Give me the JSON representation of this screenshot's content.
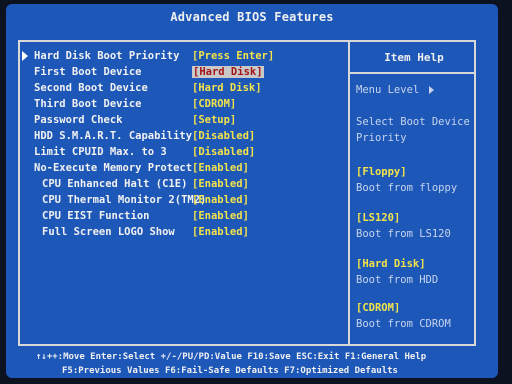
{
  "title": "Advanced BIOS Features",
  "items": [
    {
      "label": "Hard Disk Boot Priority",
      "value": "[Press Enter]"
    },
    {
      "label": "First Boot Device",
      "value": "[Hard Disk]"
    },
    {
      "label": "Second Boot Device",
      "value": "[Hard Disk]"
    },
    {
      "label": "Third Boot Device",
      "value": "[CDROM]"
    },
    {
      "label": "Password Check",
      "value": "[Setup]"
    },
    {
      "label": "HDD S.M.A.R.T. Capability",
      "value": "[Disabled]"
    },
    {
      "label": "Limit CPUID Max. to 3",
      "value": "[Disabled]"
    },
    {
      "label": "No-Execute Memory Protect",
      "value": "[Enabled]"
    },
    {
      "label": "CPU Enhanced Halt (C1E)",
      "value": "[Enabled]"
    },
    {
      "label": "CPU Thermal Monitor 2(TM2)",
      "value": "[Enabled]"
    },
    {
      "label": "CPU EIST Function",
      "value": "[Enabled]"
    },
    {
      "label": "Full Screen LOGO Show",
      "value": "[Enabled]"
    }
  ],
  "help": {
    "title": "Item Help",
    "menu_level": "Menu Level",
    "line1": "Select Boot Device",
    "line2": "Priority",
    "options": [
      {
        "key": "[Floppy]",
        "desc": "Boot from floppy"
      },
      {
        "key": "[LS120]",
        "desc": "Boot from LS120"
      },
      {
        "key": "[Hard Disk]",
        "desc": "Boot from HDD"
      },
      {
        "key": "[CDROM]",
        "desc": "Boot from CDROM"
      }
    ]
  },
  "footer": {
    "line1": "↑↓++:Move  Enter:Select  +/-/PU/PD:Value  F10:Save  ESC:Exit  F1:General Help",
    "line2": "F5:Previous Values   F6:Fail-Safe Defaults   F7:Optimized Defaults"
  },
  "colors": {
    "background": "#1d57b8",
    "value": "#f4e34a",
    "highlight_bg": "#c9c9c9",
    "highlight_text": "#a31515"
  }
}
